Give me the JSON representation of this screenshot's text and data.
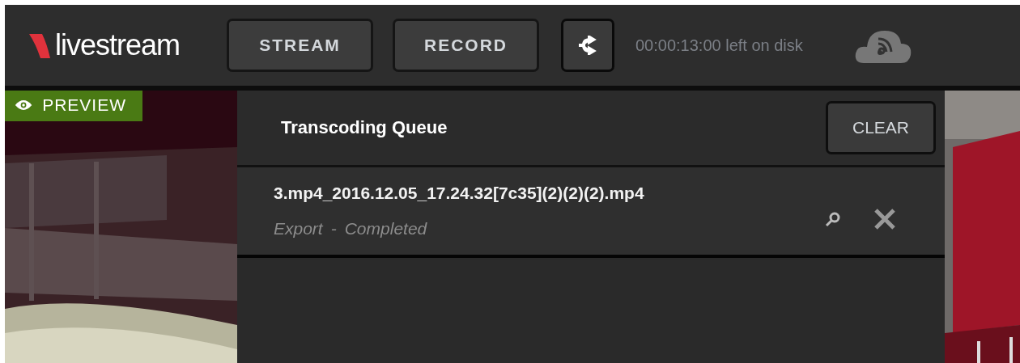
{
  "logo": {
    "text": "livestream"
  },
  "toolbar": {
    "buttons": [
      {
        "label": "STREAM"
      },
      {
        "label": "RECORD"
      }
    ],
    "disk_time": "00:00:13:00 left on disk"
  },
  "preview": {
    "label": "PREVIEW"
  },
  "queue": {
    "title": "Transcoding Queue",
    "clear_button": "CLEAR",
    "items": [
      {
        "filename": "3.mp4_2016.12.05_17.24.32[7c35](2)(2)(2).mp4",
        "operation": "Export",
        "separator": "-",
        "status": "Completed"
      }
    ]
  }
}
